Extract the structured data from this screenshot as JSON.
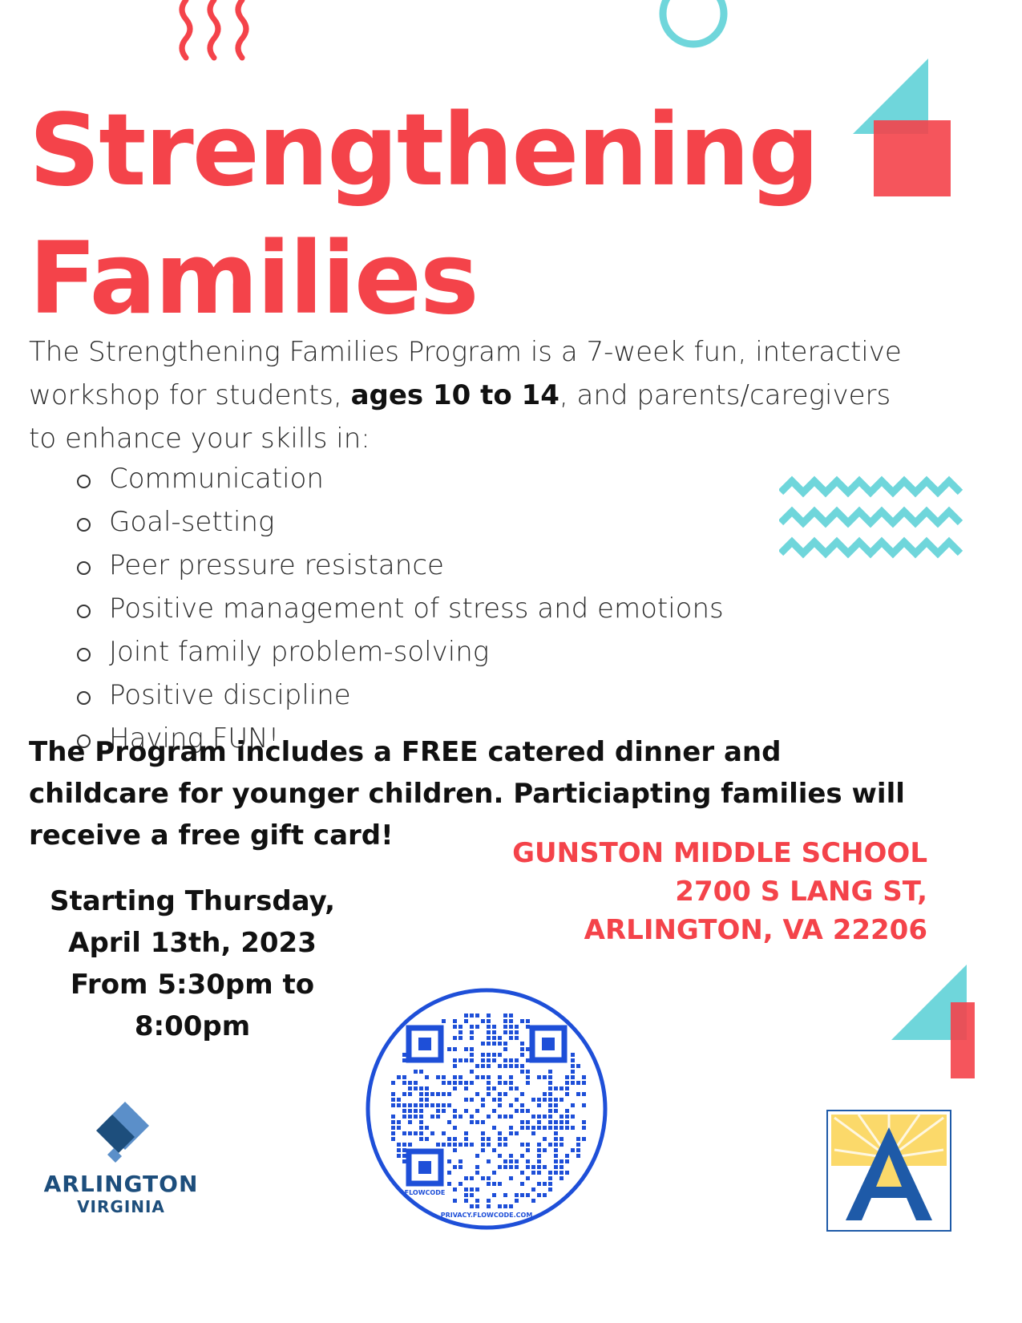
{
  "title": {
    "line1": "Strengthening",
    "line2": "Families"
  },
  "intro": {
    "part1": "The Strengthening Families Program is a 7-week fun, interactive workshop for students, ",
    "bold": "ages 10 to 14",
    "part2": ", and parents/caregivers to enhance your skills in:"
  },
  "skills": [
    "Communication",
    "Goal-setting",
    "Peer pressure resistance",
    "Positive management of stress and emotions",
    "Joint family problem-solving",
    "Positive discipline",
    "Having FUN!"
  ],
  "free_offer": "The Program includes a FREE catered dinner and childcare for younger children. Particiapting families will receive a free gift card!",
  "location": {
    "line1": "GUNSTON MIDDLE SCHOOL",
    "line2": "2700 S LANG ST,",
    "line3": "ARLINGTON, VA 22206"
  },
  "schedule": {
    "line1": "Starting Thursday,",
    "line2": "April 13th, 2023",
    "line3": "From 5:30pm to",
    "line4": "8:00pm"
  },
  "logos": {
    "arlington": {
      "name": "ARLINGTON",
      "sub": "VIRGINIA"
    },
    "qr": {
      "brand": "FLOWCODE",
      "url": "PRIVACY.FLOWCODE.COM"
    }
  },
  "colors": {
    "accent_red": "#f4434a",
    "accent_teal": "#6fd6db",
    "qr_blue": "#1e4fd8",
    "arlington_navy": "#1d4e7c"
  }
}
